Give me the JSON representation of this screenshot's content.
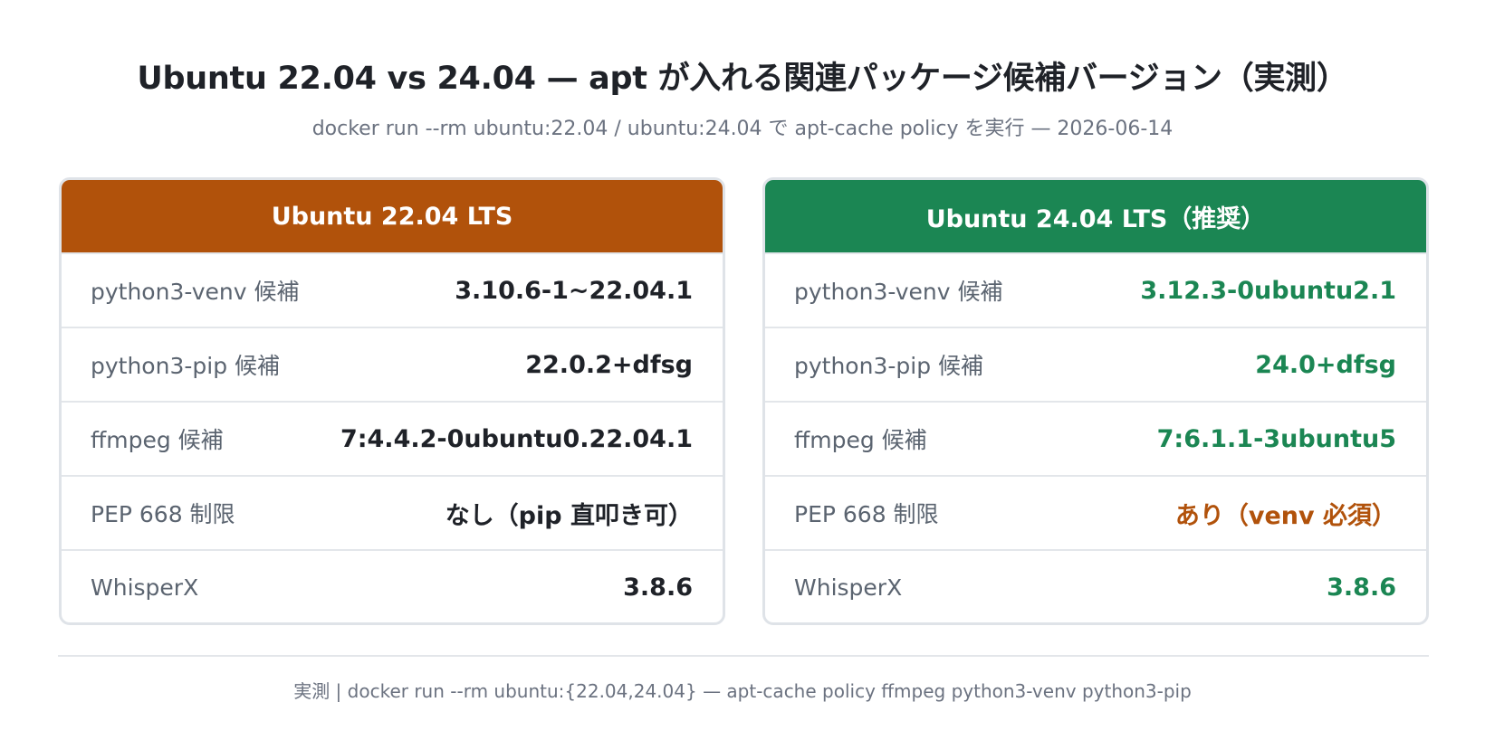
{
  "header": {
    "title": "Ubuntu 22.04 vs 24.04 — apt が入れる関連パッケージ候補バージョン（実測）",
    "subtitle": "docker run --rm ubuntu:22.04 / ubuntu:24.04 で apt-cache policy を実行 — 2026-06-14"
  },
  "colors": {
    "ubuntu2204_header": "#b1520b",
    "ubuntu2404_header": "#1b8653",
    "positive_value": "#1b8653",
    "warning_value": "#b1520b"
  },
  "cards": [
    {
      "title": "Ubuntu 22.04 LTS",
      "rows": [
        {
          "label": "python3-venv 候補",
          "value": "3.10.6-1~22.04.1"
        },
        {
          "label": "python3-pip 候補",
          "value": "22.0.2+dfsg"
        },
        {
          "label": "ffmpeg 候補",
          "value": "7:4.4.2-0ubuntu0.22.04.1"
        },
        {
          "label": "PEP 668 制限",
          "value": "なし（pip 直叩き可）"
        },
        {
          "label": "WhisperX",
          "value": "3.8.6"
        }
      ]
    },
    {
      "title": "Ubuntu 24.04 LTS（推奨）",
      "rows": [
        {
          "label": "python3-venv 候補",
          "value": "3.12.3-0ubuntu2.1"
        },
        {
          "label": "python3-pip 候補",
          "value": "24.0+dfsg"
        },
        {
          "label": "ffmpeg 候補",
          "value": "7:6.1.1-3ubuntu5"
        },
        {
          "label": "PEP 668 制限",
          "value": "あり（venv 必須）"
        },
        {
          "label": "WhisperX",
          "value": "3.8.6"
        }
      ]
    }
  ],
  "footer": {
    "text": "実測 | docker run --rm ubuntu:{22.04,24.04} — apt-cache policy ffmpeg python3-venv python3-pip"
  }
}
